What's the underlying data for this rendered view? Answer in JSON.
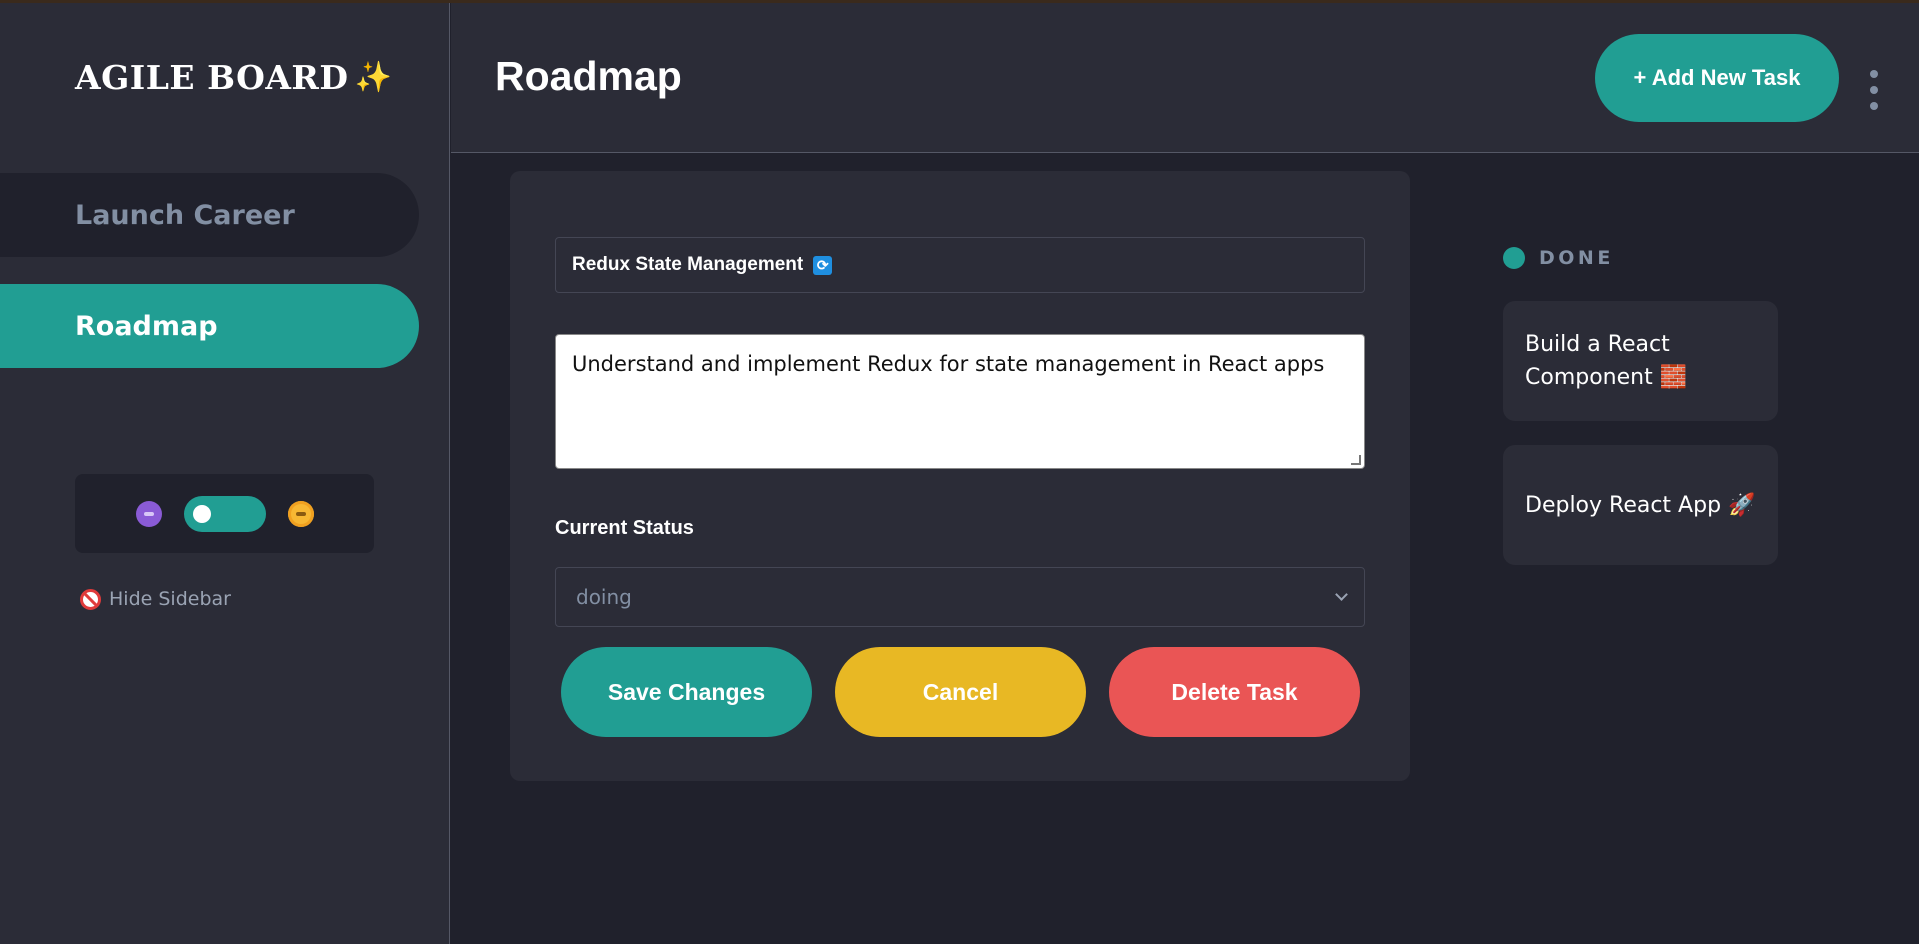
{
  "sidebar": {
    "logo": "AGILE BOARD",
    "logo_icon": "✨",
    "boards": [
      {
        "label": "Launch Career",
        "active": false
      },
      {
        "label": "Roadmap",
        "active": true
      }
    ],
    "theme_toggle": {
      "dark_icon": "moon-icon",
      "light_icon": "sun-icon",
      "state": "dark"
    },
    "hide_sidebar_label": "Hide Sidebar"
  },
  "header": {
    "title": "Roadmap",
    "add_task_label": "+ Add New Task"
  },
  "task_form": {
    "title_value": "Redux State Management",
    "title_icon": "🔄",
    "description_value": "Understand and implement Redux for state management in React apps",
    "status_label": "Current Status",
    "status_value": "doing",
    "save_label": "Save Changes",
    "cancel_label": "Cancel",
    "delete_label": "Delete Task"
  },
  "column": {
    "title": "DONE",
    "dot_color": "#219e93",
    "cards": [
      {
        "text": "Build a React Component 🧱"
      },
      {
        "text": "Deploy React App 🚀"
      }
    ]
  },
  "colors": {
    "accent": "#219e93",
    "warning": "#e8b824",
    "danger": "#ea5555",
    "panel": "#2b2c37",
    "background": "#20212c"
  }
}
